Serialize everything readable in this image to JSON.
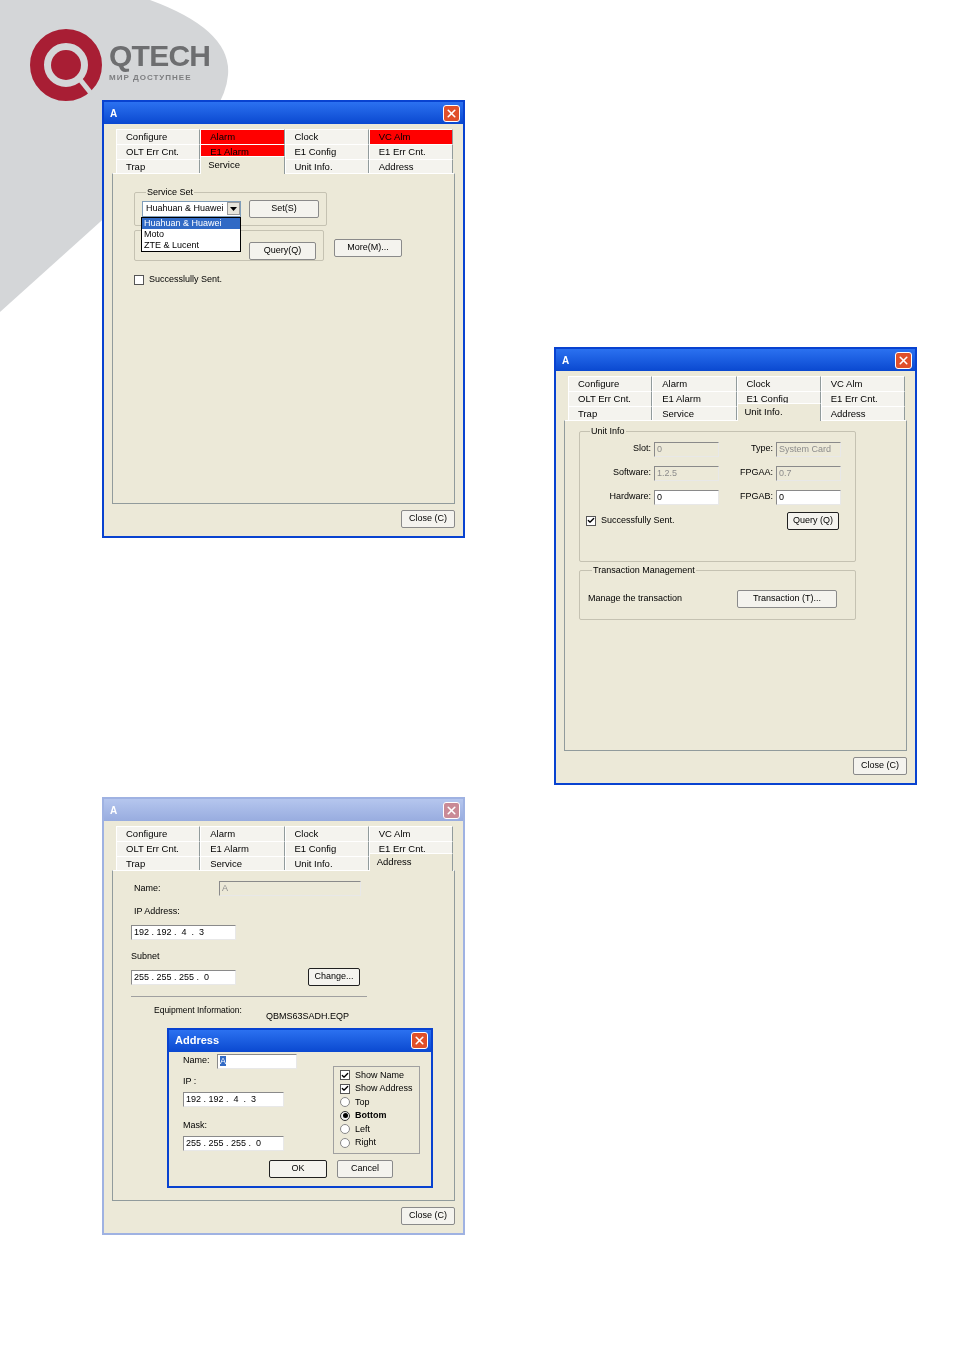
{
  "logo": {
    "name": "QTECH",
    "tagline": "МИР ДОСТУПНЕЕ"
  },
  "windows": [
    {
      "title": "A",
      "active": true,
      "tabs": [
        {
          "label": "Configure",
          "selected": false,
          "alarm": false
        },
        {
          "label": "Alarm",
          "selected": false,
          "alarm": true
        },
        {
          "label": "Clock",
          "selected": false,
          "alarm": false
        },
        {
          "label": "VC Alm",
          "selected": false,
          "alarm": true
        },
        {
          "label": "OLT Err Cnt.",
          "selected": false,
          "alarm": false
        },
        {
          "label": "E1 Alarm",
          "selected": false,
          "alarm": true
        },
        {
          "label": "E1 Config",
          "selected": false,
          "alarm": false
        },
        {
          "label": "E1 Err Cnt.",
          "selected": false,
          "alarm": false
        },
        {
          "label": "Trap",
          "selected": false,
          "alarm": false
        },
        {
          "label": "Service",
          "selected": true,
          "alarm": false
        },
        {
          "label": "Unit Info.",
          "selected": false,
          "alarm": false
        },
        {
          "label": "Address",
          "selected": false,
          "alarm": false
        }
      ],
      "content": {
        "kind": "service",
        "group_title": "Service Set",
        "combo": {
          "value": "Huahuan & Huawei",
          "expanded": true,
          "options": [
            {
              "label": "Huahuan & Huawei",
              "selected": true
            },
            {
              "label": "Moto",
              "selected": false
            },
            {
              "label": "ZTE & Lucent",
              "selected": false
            }
          ]
        },
        "set_button": "Set(S)",
        "query_button": "Query(Q)",
        "more_button": "More(M)...",
        "checkbox": {
          "label": "Successlully Sent.",
          "checked": false
        }
      },
      "close_button": "Close (C)"
    },
    {
      "title": "A",
      "active": true,
      "tabs": [
        {
          "label": "Configure",
          "selected": false,
          "alarm": false
        },
        {
          "label": "Alarm",
          "selected": false,
          "alarm": false
        },
        {
          "label": "Clock",
          "selected": false,
          "alarm": false
        },
        {
          "label": "VC Alm",
          "selected": false,
          "alarm": false
        },
        {
          "label": "OLT Err Cnt.",
          "selected": false,
          "alarm": false
        },
        {
          "label": "E1 Alarm",
          "selected": false,
          "alarm": false
        },
        {
          "label": "E1 Config",
          "selected": false,
          "alarm": false
        },
        {
          "label": "E1 Err Cnt.",
          "selected": false,
          "alarm": false
        },
        {
          "label": "Trap",
          "selected": false,
          "alarm": false
        },
        {
          "label": "Service",
          "selected": false,
          "alarm": false
        },
        {
          "label": "Unit Info.",
          "selected": true,
          "alarm": false
        },
        {
          "label": "Address",
          "selected": false,
          "alarm": false
        }
      ],
      "content": {
        "kind": "unit_info",
        "group_title": "Unit Info",
        "fields": [
          {
            "label": "Slot:",
            "value": "0",
            "disabled": true
          },
          {
            "label": "Type:",
            "value": "System Card",
            "disabled": true
          },
          {
            "label": "Software:",
            "value": "1.2.5",
            "disabled": true
          },
          {
            "label": "FPGAA:",
            "value": "0.7",
            "disabled": true
          },
          {
            "label": "Hardware:",
            "value": "0",
            "disabled": false
          },
          {
            "label": "FPGAB:",
            "value": "0",
            "disabled": false
          }
        ],
        "checkbox": {
          "label": "Successfully Sent.",
          "checked": true
        },
        "query_button": "Query (Q)",
        "transaction": {
          "title": "Transaction Management",
          "text": "Manage the transaction",
          "button": "Transaction (T)..."
        }
      },
      "close_button": "Close (C)"
    },
    {
      "title": "A",
      "active": false,
      "tabs": [
        {
          "label": "Configure",
          "selected": false,
          "alarm": false
        },
        {
          "label": "Alarm",
          "selected": false,
          "alarm": false
        },
        {
          "label": "Clock",
          "selected": false,
          "alarm": false
        },
        {
          "label": "VC Alm",
          "selected": false,
          "alarm": false
        },
        {
          "label": "OLT Err Cnt.",
          "selected": false,
          "alarm": false
        },
        {
          "label": "E1 Alarm",
          "selected": false,
          "alarm": false
        },
        {
          "label": "E1 Config",
          "selected": false,
          "alarm": false
        },
        {
          "label": "E1 Err Cnt.",
          "selected": false,
          "alarm": false
        },
        {
          "label": "Trap",
          "selected": false,
          "alarm": false
        },
        {
          "label": "Service",
          "selected": false,
          "alarm": false
        },
        {
          "label": "Unit Info.",
          "selected": false,
          "alarm": false
        },
        {
          "label": "Address",
          "selected": true,
          "alarm": false
        }
      ],
      "content": {
        "kind": "address",
        "name_label": "Name:",
        "name_value": "A",
        "ip_label": "IP Address:",
        "ip_value": "192 . 192 .  4  .  3",
        "subnet_label": "Subnet",
        "subnet_value": "255 . 255 . 255 .  0",
        "change_button": "Change...",
        "equipment_label": "Equipment Information:",
        "equipment_value": "QBMS63SADH.EQP",
        "dialog": {
          "title": "Address",
          "active": true,
          "name_label": "Name:",
          "name_value": "A",
          "ip_label": "IP :",
          "ip_value": "192 . 192 .  4  .  3",
          "mask_label": "Mask:",
          "mask_value": "255 . 255 . 255 .  0",
          "options": [
            {
              "kind": "checkbox",
              "label": "Show Name",
              "checked": true
            },
            {
              "kind": "checkbox",
              "label": "Show Address",
              "checked": true
            },
            {
              "kind": "radio",
              "label": "Top",
              "selected": false
            },
            {
              "kind": "radio",
              "label": "Bottom",
              "selected": true
            },
            {
              "kind": "radio",
              "label": "Left",
              "selected": false
            },
            {
              "kind": "radio",
              "label": "Right",
              "selected": false
            }
          ],
          "ok_button": "OK",
          "cancel_button": "Cancel"
        }
      },
      "close_button": "Close (C)"
    }
  ]
}
